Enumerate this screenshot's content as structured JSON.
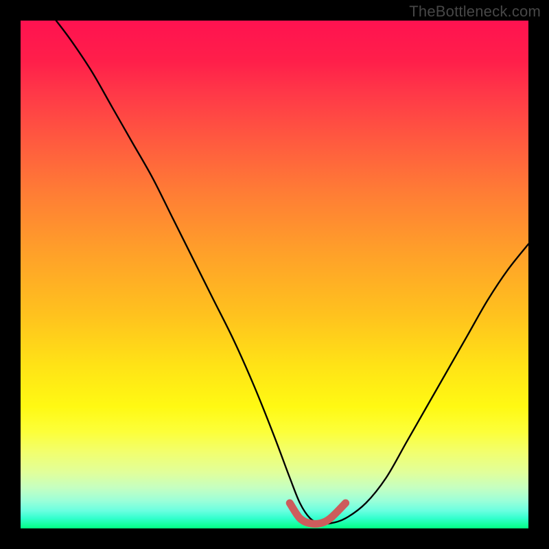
{
  "watermark": "TheBottleneck.com",
  "chart_data": {
    "type": "line",
    "title": "",
    "xlabel": "",
    "ylabel": "",
    "xlim": [
      0,
      100
    ],
    "ylim": [
      0,
      100
    ],
    "curve": {
      "x": [
        7,
        10,
        14,
        18,
        22,
        26,
        30,
        34,
        38,
        42,
        46,
        50,
        53,
        55,
        57,
        59,
        61,
        64,
        68,
        72,
        76,
        80,
        84,
        88,
        92,
        96,
        100
      ],
      "y": [
        100,
        96,
        90,
        83,
        76,
        69,
        61,
        53,
        45,
        37,
        28,
        18,
        10,
        5,
        2,
        1,
        1,
        2,
        5,
        10,
        17,
        24,
        31,
        38,
        45,
        51,
        56
      ]
    },
    "highlight_segment": {
      "x": [
        53,
        55,
        57,
        59,
        61,
        64
      ],
      "y": [
        5,
        2,
        1,
        1,
        2,
        5
      ]
    },
    "gradient_stops": [
      {
        "pos": 0.0,
        "color": "#ff1250"
      },
      {
        "pos": 0.5,
        "color": "#ffc21e"
      },
      {
        "pos": 0.8,
        "color": "#fcff3a"
      },
      {
        "pos": 1.0,
        "color": "#02ff83"
      }
    ]
  }
}
